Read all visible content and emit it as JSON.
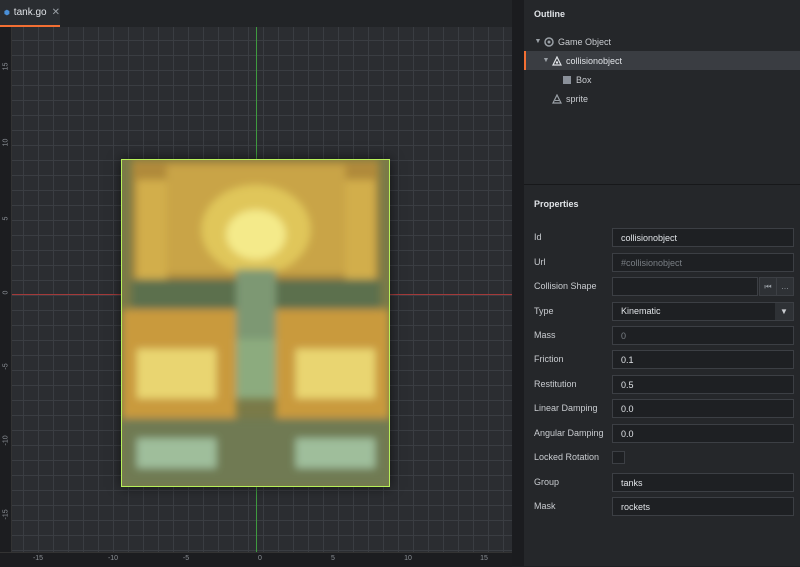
{
  "tab": {
    "label": "tank.go",
    "close": "✕"
  },
  "rulers": {
    "vertical": [
      "15",
      "10",
      "5",
      "0",
      "-5",
      "-10",
      "-15"
    ],
    "horizontal": [
      "-15",
      "-10",
      "-5",
      "0",
      "5",
      "10",
      "15"
    ]
  },
  "outline": {
    "title": "Outline",
    "items": [
      {
        "label": "Game Object",
        "icon": "game-object-icon"
      },
      {
        "label": "collisionobject",
        "icon": "collision-object-icon"
      },
      {
        "label": "Box",
        "icon": "box-shape-icon"
      },
      {
        "label": "sprite",
        "icon": "sprite-icon"
      }
    ]
  },
  "properties": {
    "title": "Properties",
    "id": {
      "label": "Id",
      "value": "collisionobject"
    },
    "url": {
      "label": "Url",
      "value": "#collisionobject"
    },
    "collision_shape": {
      "label": "Collision Shape",
      "value": "",
      "reset": "⏮",
      "browse": "…"
    },
    "type": {
      "label": "Type",
      "value": "Kinematic",
      "caret": "▼"
    },
    "mass": {
      "label": "Mass",
      "value": "0"
    },
    "friction": {
      "label": "Friction",
      "value": "0.1"
    },
    "restitution": {
      "label": "Restitution",
      "value": "0.5"
    },
    "linear_damping": {
      "label": "Linear Damping",
      "value": "0.0"
    },
    "angular_damping": {
      "label": "Angular Damping",
      "value": "0.0"
    },
    "locked_rotation": {
      "label": "Locked Rotation"
    },
    "group": {
      "label": "Group",
      "value": "tanks"
    },
    "mask": {
      "label": "Mask",
      "value": "rockets"
    }
  },
  "colors": {
    "accent": "#f36f33",
    "selection_outline": "#b7f05a",
    "x_axis": "#a33a3a",
    "y_axis": "#3f9a3f"
  }
}
